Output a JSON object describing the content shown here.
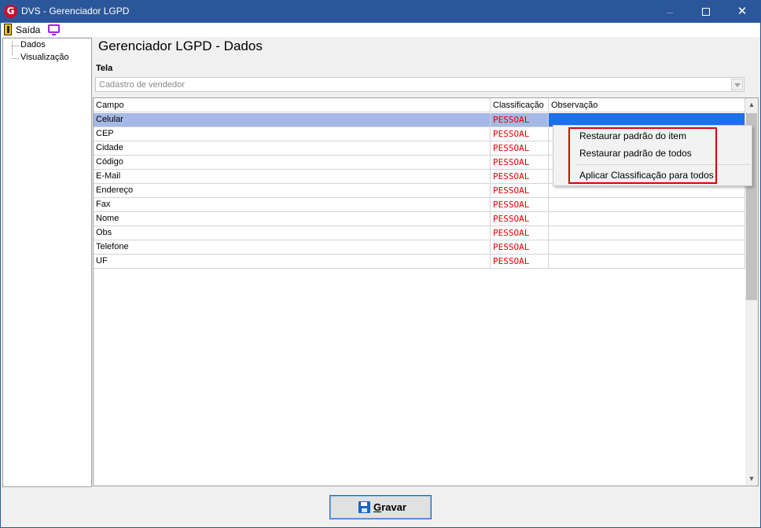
{
  "window": {
    "title": "DVS - Gerenciador LGPD",
    "icon_letter": "G"
  },
  "menubar": {
    "exit_label": "Saída"
  },
  "tree": {
    "items": [
      {
        "label": "Dados"
      },
      {
        "label": "Visualização"
      }
    ]
  },
  "main": {
    "page_title": "Gerenciador LGPD - Dados",
    "tela_label": "Tela",
    "tela_value": "Cadastro de vendedor"
  },
  "grid": {
    "columns": [
      "Campo",
      "Classificação",
      "Observação"
    ],
    "rows": [
      {
        "campo": "Celular",
        "classificacao": "PESSOAL",
        "observacao": "",
        "selected": true
      },
      {
        "campo": "CEP",
        "classificacao": "PESSOAL",
        "observacao": ""
      },
      {
        "campo": "Cidade",
        "classificacao": "PESSOAL",
        "observacao": ""
      },
      {
        "campo": "Código",
        "classificacao": "PESSOAL",
        "observacao": ""
      },
      {
        "campo": "E-Mail",
        "classificacao": "PESSOAL",
        "observacao": ""
      },
      {
        "campo": "Endereço",
        "classificacao": "PESSOAL",
        "observacao": ""
      },
      {
        "campo": "Fax",
        "classificacao": "PESSOAL",
        "observacao": ""
      },
      {
        "campo": "Nome",
        "classificacao": "PESSOAL",
        "observacao": ""
      },
      {
        "campo": "Obs",
        "classificacao": "PESSOAL",
        "observacao": ""
      },
      {
        "campo": "Telefone",
        "classificacao": "PESSOAL",
        "observacao": ""
      },
      {
        "campo": "UF",
        "classificacao": "PESSOAL",
        "observacao": ""
      }
    ]
  },
  "context_menu": {
    "items": [
      {
        "label": "Restaurar padrão do item"
      },
      {
        "label": "Restaurar padrão de todos"
      },
      {
        "label": "Aplicar Classificação para todos"
      }
    ]
  },
  "footer": {
    "save_label_first": "G",
    "save_label_rest": "ravar"
  },
  "colors": {
    "titlebar": "#2b579a",
    "classification_text": "#e00000",
    "selected_row": "#a4b9e6",
    "selected_cell": "#1e6fe8",
    "highlight_box": "#e00000"
  },
  "icons": {
    "app": "app-logo-icon",
    "exit": "exit-door-icon",
    "view": "monitor-icon",
    "save": "floppy-disk-icon"
  }
}
